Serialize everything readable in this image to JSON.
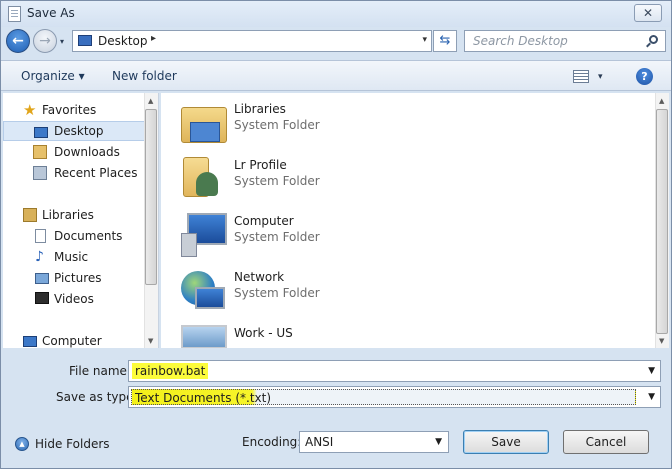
{
  "window": {
    "title": "Save As",
    "close_glyph": "✕"
  },
  "nav": {
    "back_glyph": "←",
    "forward_glyph": "→",
    "history_glyph": "▾",
    "address": {
      "location": "Desktop",
      "separator": "▸",
      "dropdown_glyph": "▾"
    },
    "refresh_glyph": "⇆",
    "search": {
      "placeholder": "Search Desktop"
    }
  },
  "toolbar": {
    "organize_label": "Organize ▾",
    "new_folder_label": "New folder",
    "views_drop_glyph": "▾",
    "help_glyph": "?"
  },
  "sidebar": {
    "items": [
      {
        "label": "Favorites",
        "icon": "star-icon"
      },
      {
        "label": "Desktop",
        "icon": "desktop-icon",
        "selected": true
      },
      {
        "label": "Downloads",
        "icon": "downloads-icon"
      },
      {
        "label": "Recent Places",
        "icon": "recent-places-icon"
      },
      {
        "label": "Libraries",
        "icon": "libraries-icon"
      },
      {
        "label": "Documents",
        "icon": "documents-icon"
      },
      {
        "label": "Music",
        "icon": "music-icon"
      },
      {
        "label": "Pictures",
        "icon": "pictures-icon"
      },
      {
        "label": "Videos",
        "icon": "videos-icon"
      },
      {
        "label": "Computer",
        "icon": "computer-icon"
      }
    ],
    "star_glyph": "★",
    "music_glyph": "♪"
  },
  "files": [
    {
      "name": "Libraries",
      "type": "System Folder",
      "icon": "libraries-folder-icon"
    },
    {
      "name": "Lr Profile",
      "type": "System Folder",
      "icon": "user-folder-icon"
    },
    {
      "name": "Computer",
      "type": "System Folder",
      "icon": "computer-icon"
    },
    {
      "name": "Network",
      "type": "System Folder",
      "icon": "network-icon"
    },
    {
      "name": "Work - US",
      "type": "",
      "icon": "image-file-icon"
    }
  ],
  "scroll": {
    "up_glyph": "▲",
    "down_glyph": "▼"
  },
  "form": {
    "file_name_label": "File name:",
    "file_name_value": "rainbow.bat",
    "save_type_label": "Save as type:",
    "save_type_value": "Text Documents (*.txt)",
    "dropdown_glyph": "▼"
  },
  "footer": {
    "hide_folders_label": "Hide Folders",
    "hide_glyph": "▲",
    "encoding_label": "Encoding:",
    "encoding_value": "ANSI",
    "save_label": "Save",
    "cancel_label": "Cancel"
  },
  "colors": {
    "highlight": "#fcfc3b",
    "accent": "#1f5fb4"
  }
}
